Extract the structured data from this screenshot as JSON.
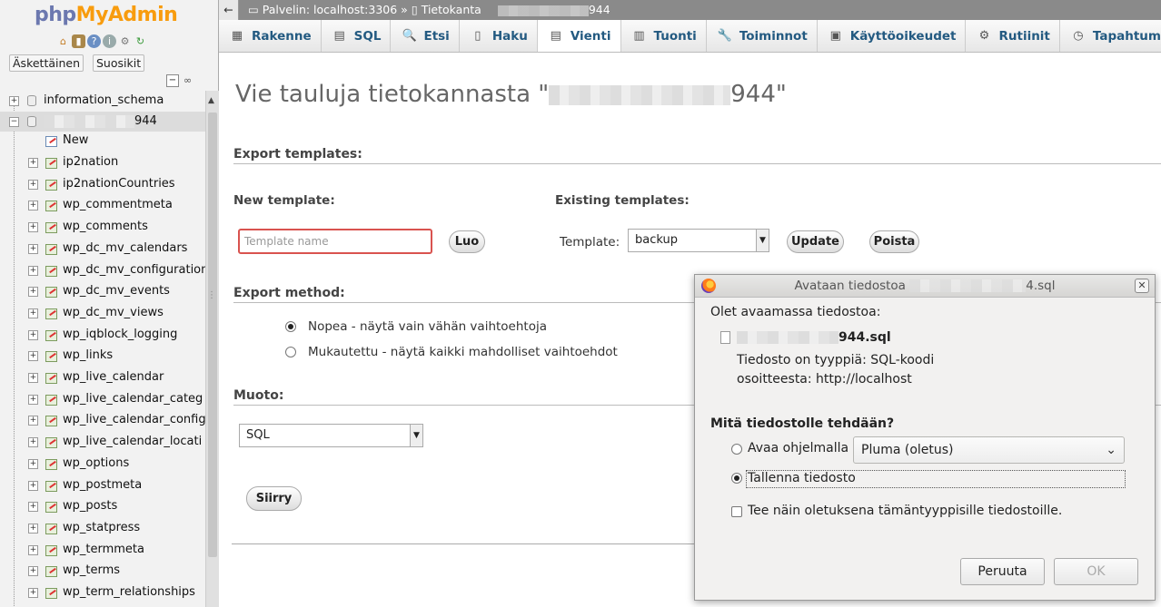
{
  "sidebar": {
    "logo_php": "php",
    "logo_myadmin": "MyAdmin",
    "recent_label": "Äskettäinen",
    "favorites_label": "Suosikit",
    "databases": [
      {
        "name": "information_schema",
        "expanded": false
      },
      {
        "name": "944",
        "expanded": true
      }
    ],
    "new_label": "New",
    "tables": [
      "ip2nation",
      "ip2nationCountries",
      "wp_commentmeta",
      "wp_comments",
      "wp_dc_mv_calendars",
      "wp_dc_mv_configuration",
      "wp_dc_mv_events",
      "wp_dc_mv_views",
      "wp_iqblock_logging",
      "wp_links",
      "wp_live_calendar",
      "wp_live_calendar_categ",
      "wp_live_calendar_config",
      "wp_live_calendar_locati",
      "wp_options",
      "wp_postmeta",
      "wp_posts",
      "wp_statpress",
      "wp_termmeta",
      "wp_terms",
      "wp_term_relationships"
    ]
  },
  "breadcrumb": {
    "server": "Palvelin: localhost:3306",
    "separator": "»",
    "database": "Tietokanta",
    "database_suffix": "944"
  },
  "tabs": [
    {
      "label": "Rakenne",
      "icon": "structure-icon"
    },
    {
      "label": "SQL",
      "icon": "sql-icon"
    },
    {
      "label": "Etsi",
      "icon": "search-icon"
    },
    {
      "label": "Haku",
      "icon": "query-icon"
    },
    {
      "label": "Vienti",
      "icon": "export-icon",
      "active": true
    },
    {
      "label": "Tuonti",
      "icon": "import-icon"
    },
    {
      "label": "Toiminnot",
      "icon": "wrench-icon"
    },
    {
      "label": "Käyttöoikeudet",
      "icon": "privileges-icon"
    },
    {
      "label": "Rutiinit",
      "icon": "routines-icon"
    },
    {
      "label": "Tapahtum",
      "icon": "events-icon"
    }
  ],
  "main": {
    "title_prefix": "Vie tauluja tietokannasta \"",
    "title_suffix": "944\"",
    "export_templates": "Export templates:",
    "new_template": "New template:",
    "template_name_placeholder": "Template name",
    "create_button": "Luo",
    "existing_templates": "Existing templates:",
    "template_label": "Template:",
    "template_selected": "backup",
    "update_button": "Update",
    "delete_button": "Poista",
    "export_method": "Export method:",
    "method_quick": "Nopea - näytä vain vähän vaihtoehtoja",
    "method_custom": "Mukautettu - näytä kaikki mahdolliset vaihtoehdot",
    "format_label": "Muoto:",
    "format_selected": "SQL",
    "go_button": "Siirry"
  },
  "dialog": {
    "title_prefix": "Avataan tiedostoa",
    "title_suffix": "4.sql",
    "opening": "Olet avaamassa tiedostoa:",
    "filename_suffix": "944.sql",
    "type_line": "Tiedosto on tyyppiä: SQL-koodi",
    "from_line": "osoitteesta:  http://localhost",
    "question": "Mitä tiedostolle tehdään?",
    "open_with": "Avaa ohjelmalla",
    "open_with_app": "Pluma (oletus)",
    "save_file": "Tallenna tiedosto",
    "remember": "Tee näin oletuksena tämäntyyppisille tiedostoille.",
    "cancel": "Peruuta",
    "ok": "OK"
  }
}
